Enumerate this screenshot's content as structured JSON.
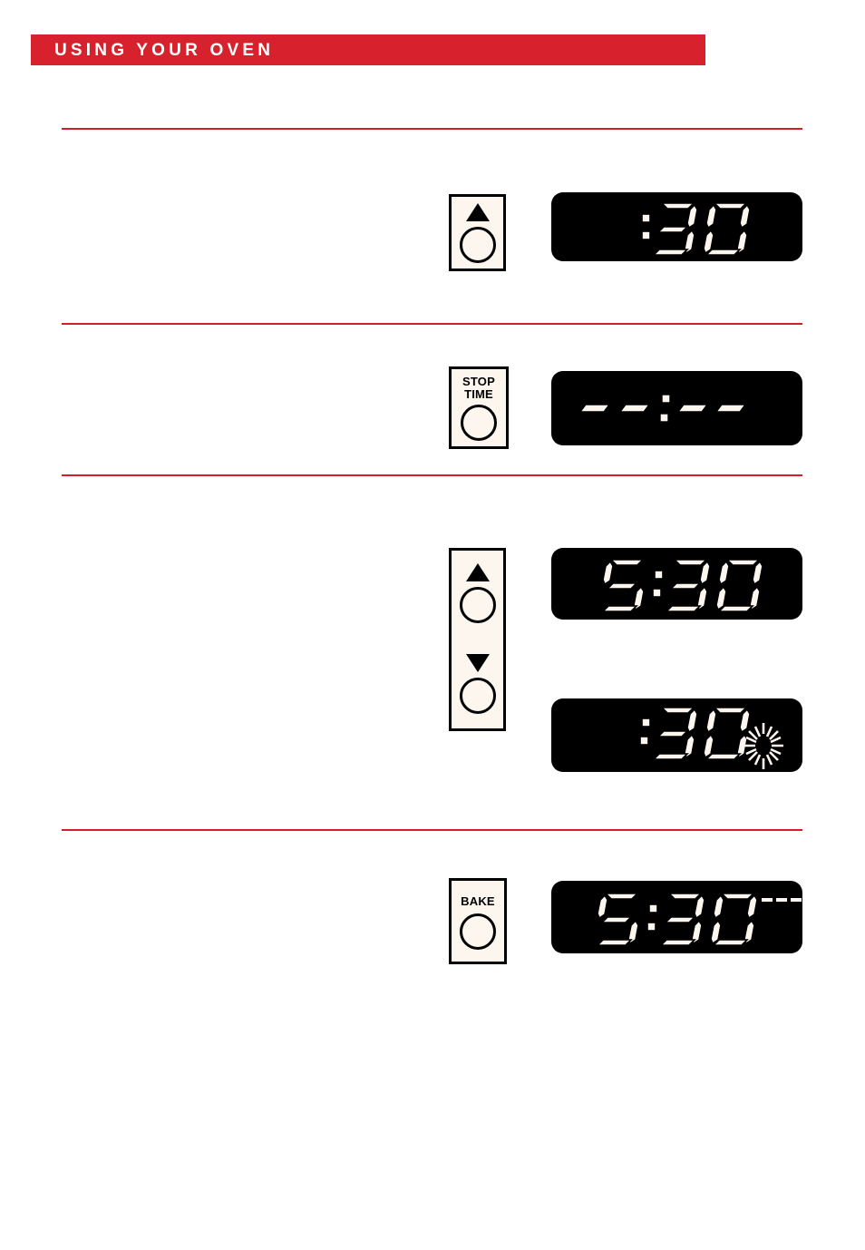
{
  "header": {
    "title": "USING YOUR OVEN",
    "banner_color": "#d7222e",
    "text_color": "#ffffff"
  },
  "theme": {
    "rule_color": "#cf1f2b",
    "key_face_color": "#fdf6ef",
    "display_background": "#000000",
    "display_segment_color": "#fdf6ef",
    "outline_color": "#000000",
    "page_background": "#ffffff"
  },
  "steps": [
    {
      "id": "step-set-cook-time",
      "key": {
        "name": "up-arrow-key",
        "label": "",
        "icons": [
          "triangle-up-icon",
          "round-button-icon"
        ]
      },
      "displays": [
        {
          "name": "cook-time-display",
          "value": ":30",
          "suffix": "",
          "indicator": "none"
        }
      ]
    },
    {
      "id": "step-stop-time",
      "key": {
        "name": "stop-time-key",
        "label": "STOP TIME",
        "label_line1": "STOP",
        "label_line2": "TIME",
        "icons": [
          "round-button-icon"
        ]
      },
      "displays": [
        {
          "name": "stop-time-display",
          "value": "- -:- -",
          "suffix": "",
          "indicator": "none"
        }
      ]
    },
    {
      "id": "step-adjust-stop-time",
      "key": {
        "name": "up-down-arrow-key",
        "label": "",
        "icons": [
          "triangle-up-icon",
          "round-button-icon",
          "triangle-down-icon",
          "round-button-icon"
        ]
      },
      "displays": [
        {
          "name": "stop-time-value-display",
          "value": "5:30",
          "suffix": "",
          "indicator": "none"
        },
        {
          "name": "cook-time-flashing-display",
          "value": ":30",
          "suffix": "",
          "indicator": "starburst-flash-icon"
        }
      ]
    },
    {
      "id": "step-bake",
      "key": {
        "name": "bake-key",
        "label": "BAKE",
        "label_line1": "BAKE",
        "label_line2": "",
        "icons": [
          "round-button-icon"
        ]
      },
      "displays": [
        {
          "name": "bake-temperature-display",
          "value": "5:30",
          "suffix": "- - -",
          "suffix_symbol": "degree-icon",
          "indicator": "none"
        }
      ]
    }
  ]
}
